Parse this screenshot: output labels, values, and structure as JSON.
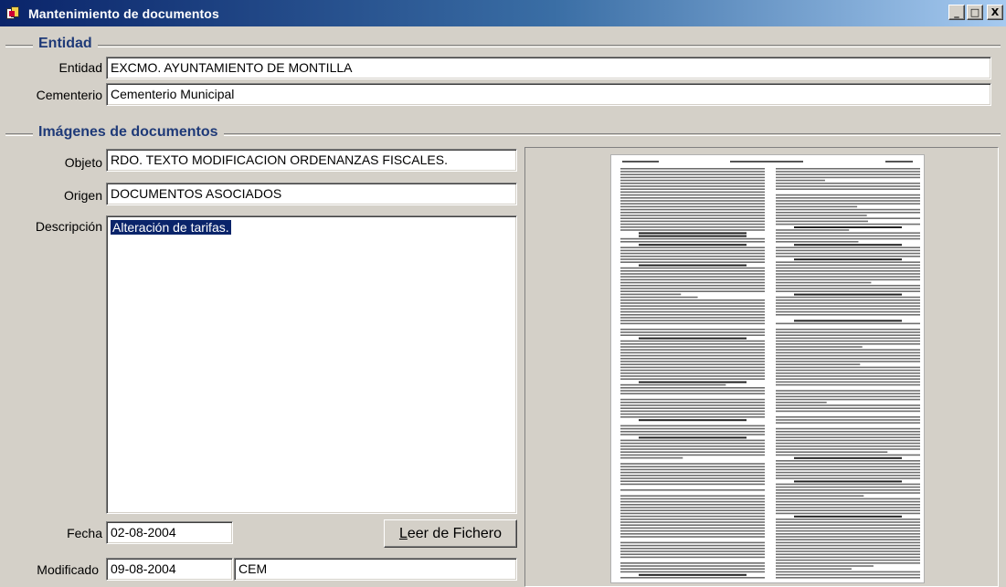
{
  "window": {
    "title": "Mantenimiento de documentos",
    "controls": [
      "_",
      "□",
      "X"
    ]
  },
  "entidad_group": {
    "title": "Entidad",
    "entidad_label": "Entidad",
    "entidad_value": "EXCMO. AYUNTAMIENTO DE MONTILLA",
    "cementerio_label": "Cementerio",
    "cementerio_value": "Cementerio Municipal"
  },
  "imagenes_group": {
    "title": "Imágenes de documentos",
    "objeto_label": "Objeto",
    "objeto_value": "RDO. TEXTO MODIFICACION ORDENANZAS FISCALES.",
    "origen_label": "Origen",
    "origen_value": "DOCUMENTOS ASOCIADOS",
    "descripcion_label": "Descripción",
    "descripcion_value": "Alteración de tarifas.",
    "fecha_label": "Fecha",
    "fecha_value": "02-08-2004",
    "leer_button_mnemonic": "L",
    "leer_button_rest": "eer de Fichero",
    "modificado_label": "Modificado",
    "modificado_date": "09-08-2004",
    "modificado_user": "CEM"
  },
  "document_preview": {
    "icon": "scanned-document-image"
  },
  "colors": {
    "title_gradient_start": "#0a246a",
    "title_gradient_end": "#a6caf0",
    "group_title": "#1f3a78",
    "selection": "#0a246a",
    "face": "#d4d0c8"
  }
}
